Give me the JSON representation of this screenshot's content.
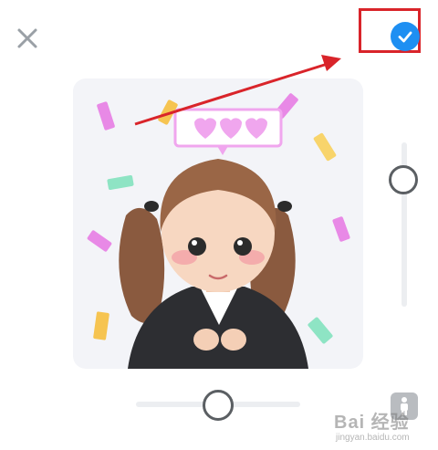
{
  "toolbar": {
    "close_icon": "close-icon",
    "confirm_icon": "checkmark-icon",
    "accent_color": "#1e8ff2",
    "highlight_color": "#d9242a"
  },
  "editor": {
    "sticker_icon": "avatar-sticker",
    "vertical_slider_level": 0.25,
    "horizontal_slider_level": 0.5,
    "body_icon": "person-icon"
  },
  "watermark": {
    "main": "Bai 经验",
    "sub": "jingyan.baidu.com"
  }
}
